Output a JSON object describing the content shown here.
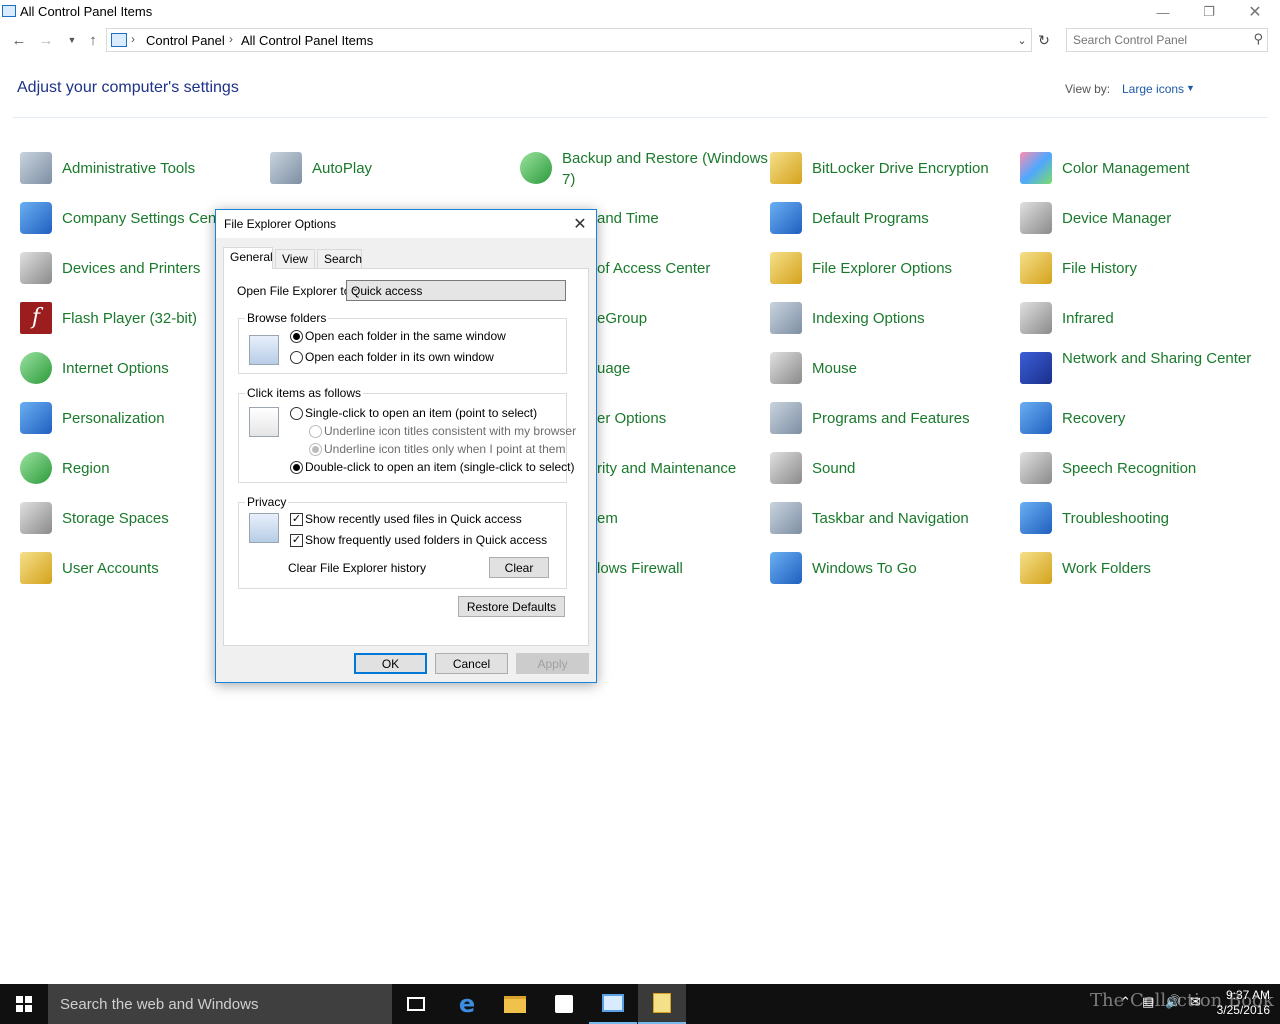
{
  "window": {
    "title": "All Control Panel Items"
  },
  "address": {
    "crumbs": [
      "Control Panel",
      "All Control Panel Items"
    ],
    "search_placeholder": "Search Control Panel"
  },
  "header": {
    "heading": "Adjust your computer's settings",
    "view_by_label": "View by:",
    "view_by_value": "Large icons"
  },
  "items": {
    "c0": [
      "Administrative Tools",
      "Company Settings Center",
      "Devices and Printers",
      "Flash Player (32-bit)",
      "Internet Options",
      "Personalization",
      "Region",
      "Storage Spaces",
      "User Accounts"
    ],
    "c1": [
      "AutoPlay"
    ],
    "c2": [
      "Backup and Restore (Windows 7)",
      "and Time",
      "of Access Center",
      "eGroup",
      "uage",
      "er Options",
      "rity and Maintenance",
      "em",
      "lows Firewall"
    ],
    "c3": [
      "BitLocker Drive Encryption",
      "Default Programs",
      "File Explorer Options",
      "Indexing Options",
      "Mouse",
      "Programs and Features",
      "Sound",
      "Taskbar and Navigation",
      "Windows To Go"
    ],
    "c4": [
      "Color Management",
      "Device Manager",
      "File History",
      "Infrared",
      "Network and Sharing Center",
      "Recovery",
      "Speech Recognition",
      "Troubleshooting",
      "Work Folders"
    ]
  },
  "dialog": {
    "title": "File Explorer Options",
    "tabs": [
      "General",
      "View",
      "Search"
    ],
    "open_to_label": "Open File Explorer to:",
    "open_to_value": "Quick access",
    "browse": {
      "title": "Browse folders",
      "opt_same": "Open each folder in the same window",
      "opt_own": "Open each folder in its own window"
    },
    "click": {
      "title": "Click items as follows",
      "opt_single": "Single-click to open an item (point to select)",
      "opt_underline_browser": "Underline icon titles consistent with my browser",
      "opt_underline_point": "Underline icon titles only when I point at them",
      "opt_double": "Double-click to open an item (single-click to select)"
    },
    "privacy": {
      "title": "Privacy",
      "chk_files": "Show recently used files in Quick access",
      "chk_folders": "Show frequently used folders in Quick access",
      "clear_label": "Clear File Explorer history",
      "clear_button": "Clear"
    },
    "restore_defaults": "Restore Defaults",
    "ok": "OK",
    "cancel": "Cancel",
    "apply": "Apply"
  },
  "taskbar": {
    "search_placeholder": "Search the web and Windows",
    "time": "9:37 AM",
    "date": "3/25/2016",
    "watermark": "The Collection Book"
  }
}
